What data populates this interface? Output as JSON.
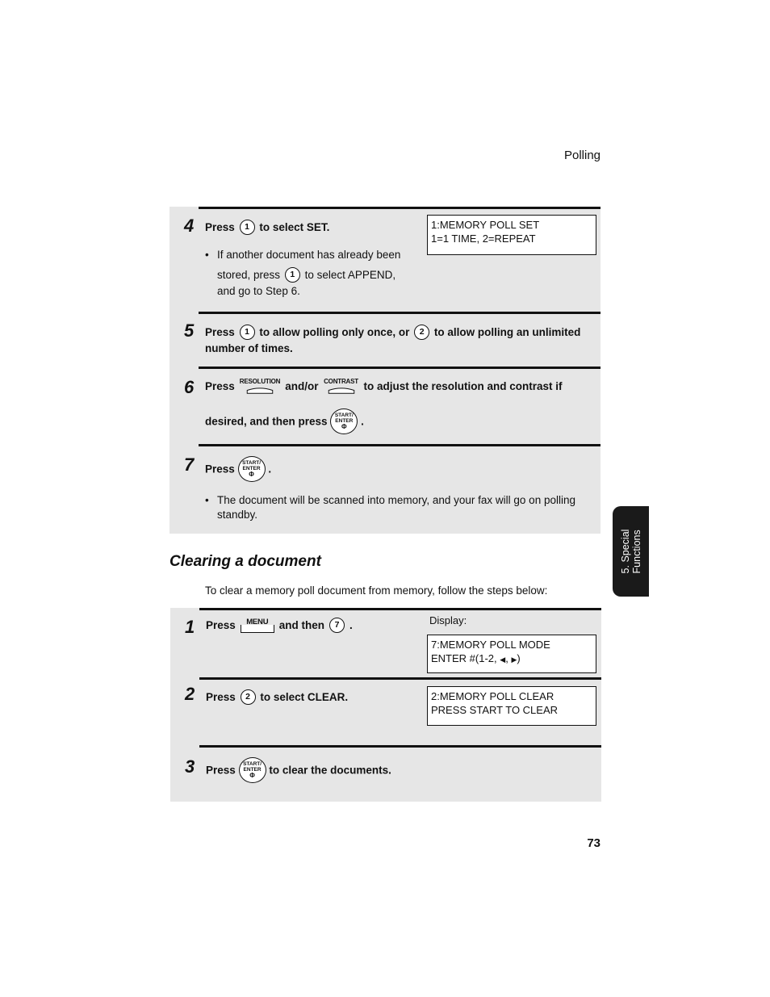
{
  "header": {
    "running_head": "Polling"
  },
  "steps_top": [
    {
      "number": "4",
      "text_pre": "Press",
      "key": "1",
      "text_post": "to select SET.",
      "bullet": {
        "line1": "If another document has already been",
        "line2_pre": "stored, press",
        "line2_key": "1",
        "line2_post": "to select APPEND,",
        "line3": "and go to Step 6."
      },
      "display": [
        "1:MEMORY POLL SET",
        "1=1 TIME, 2=REPEAT"
      ]
    },
    {
      "number": "5",
      "text_pre": "Press",
      "key1": "1",
      "text_mid": "to allow polling only once, or",
      "key2": "2",
      "text_post": "to allow polling an unlimited",
      "line2": "number of times."
    },
    {
      "number": "6",
      "text_pre": "Press",
      "key1_label": "RESOLUTION",
      "text_mid": "and/or",
      "key2_label": "CONTRAST",
      "text_post": "to adjust the resolution and contrast if",
      "line2_pre": "desired, and then press",
      "line2_post": "."
    },
    {
      "number": "7",
      "text_pre": "Press",
      "text_post": ".",
      "bullet": {
        "line1": "The document will be scanned into memory, and your fax will go on polling",
        "line2": "standby."
      }
    }
  ],
  "start_key": {
    "line1": "START/",
    "line2": "ENTER",
    "symbol": "Φ"
  },
  "section": {
    "title": "Clearing a document",
    "intro": "To clear a memory poll document from memory, follow the steps below:"
  },
  "steps_bottom": [
    {
      "number": "1",
      "text_pre": "Press",
      "key_label": "MENU",
      "text_mid": "and then",
      "key": "7",
      "text_post": ".",
      "display_label": "Display:",
      "display": [
        "7:MEMORY POLL MODE",
        "ENTER #(1-2,",
        "◀",
        ",",
        "▶",
        ")"
      ]
    },
    {
      "number": "2",
      "text_pre": "Press",
      "key": "2",
      "text_post": "to select CLEAR.",
      "display": [
        "2:MEMORY POLL CLEAR",
        "PRESS START TO CLEAR"
      ]
    },
    {
      "number": "3",
      "text_pre": "Press",
      "text_post": "to clear the documents."
    }
  ],
  "side_tab": {
    "line1": "5. Special",
    "line2": "Functions"
  },
  "footer": {
    "page_number": "73"
  }
}
